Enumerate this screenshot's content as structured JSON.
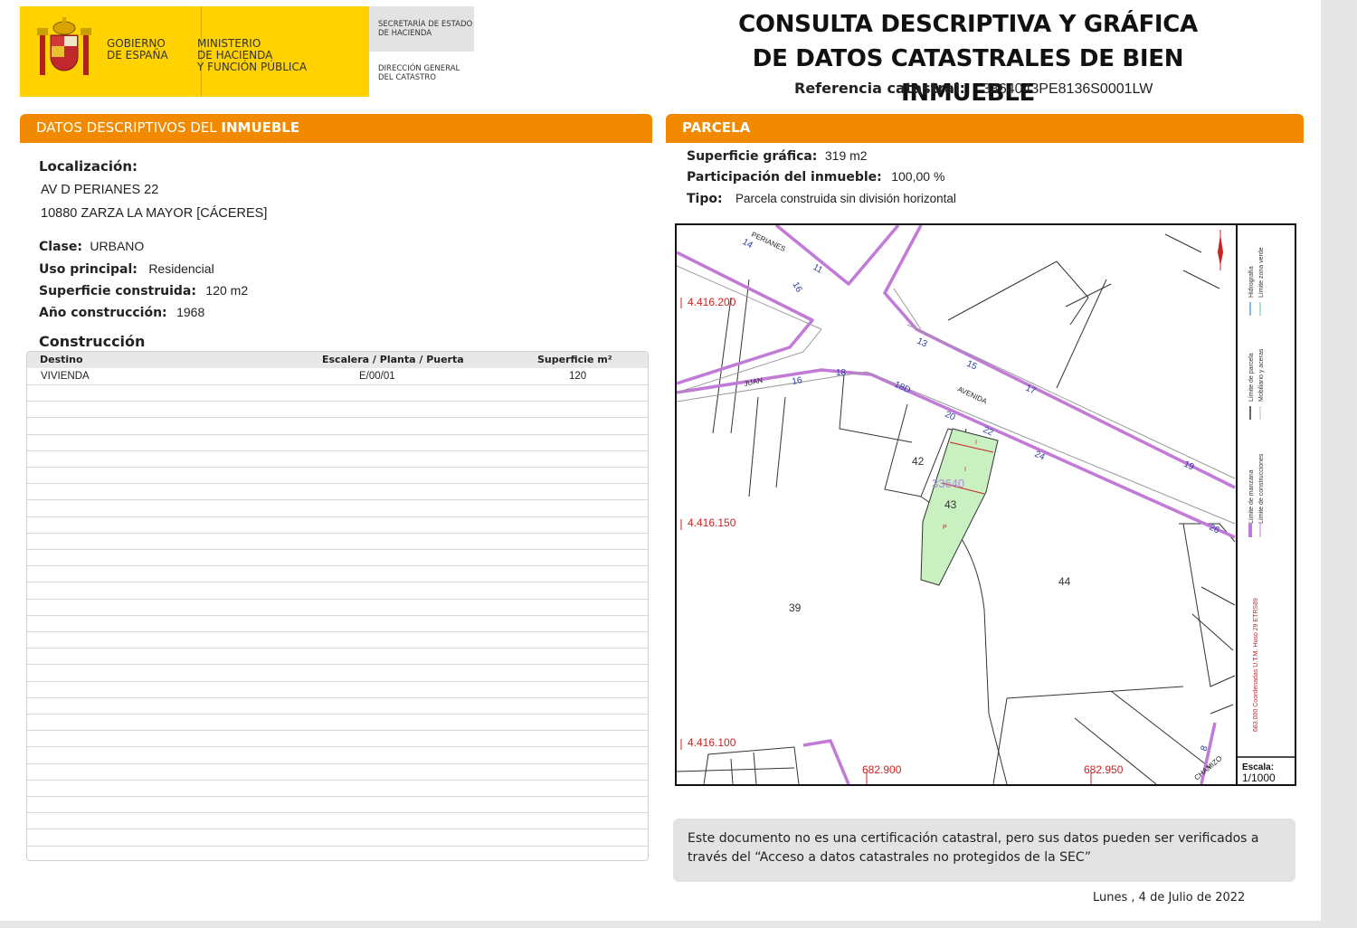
{
  "header": {
    "gobierno": [
      "GOBIERNO",
      "DE ESPAÑA"
    ],
    "ministerio": [
      "MINISTERIO",
      "DE HACIENDA",
      "Y FUNCIÓN PÚBLICA"
    ],
    "secretaria": [
      "SECRETARÍA DE ESTADO",
      "DE HACIENDA"
    ],
    "direccion": [
      "DIRECCIÓN GENERAL",
      "DEL CATASTRO"
    ],
    "title_line1": "CONSULTA DESCRIPTIVA Y GRÁFICA",
    "title_line2": "DE DATOS CATASTRALES DE BIEN INMUEBLE",
    "ref_label": "Referencia catastral:",
    "ref_value": "3364043PE8136S0001LW"
  },
  "left": {
    "section_prefix": "DATOS DESCRIPTIVOS DEL ",
    "section_bold": "INMUEBLE",
    "localizacion_label": "Localización:",
    "address1": "AV D PERIANES 22",
    "address2": "10880 ZARZA LA MAYOR [CÁCERES]",
    "clase_label": "Clase:",
    "clase_value": "URBANO",
    "uso_label": "Uso principal:",
    "uso_value": "Residencial",
    "sup_label": "Superficie construida:",
    "sup_value": "120 m2",
    "anio_label": "Año construcción:",
    "anio_value": "1968",
    "construccion_title": "Construcción",
    "table": {
      "headers": [
        "Destino",
        "Escalera / Planta / Puerta",
        "Superficie m²"
      ],
      "rows": [
        [
          "VIVIENDA",
          "E/00/01",
          "120"
        ]
      ]
    }
  },
  "right": {
    "section": "PARCELA",
    "sup_grafica_label": "Superficie gráfica:",
    "sup_grafica_value": "319 m2",
    "participacion_label": "Participación del inmueble:",
    "participacion_value": "100,00 %",
    "tipo_label": "Tipo:",
    "tipo_value": "Parcela construida sin división horizontal"
  },
  "map": {
    "northing_labels": [
      "4.416.200",
      "4.416.150",
      "4.416.100"
    ],
    "easting_labels": [
      "682.900",
      "682.950"
    ],
    "street_numbers": [
      "14",
      "11",
      "16",
      "13",
      "15",
      "17",
      "16",
      "18",
      "18D",
      "20",
      "22",
      "24",
      "19",
      "26",
      "8"
    ],
    "street_names": [
      "PERIANES",
      "JUAN",
      "AVENIDA",
      "CHAMIZO"
    ],
    "parcel_labels": [
      "42",
      "43",
      "39",
      "44"
    ],
    "highlight_label": "33640",
    "subunit_labels": [
      "I",
      "I",
      "P"
    ],
    "legend": [
      "Límite de manzana",
      "Límite de parcela",
      "Hidrografía",
      "Límite de construcciones",
      "Mobiliario y aceras",
      "Límite zona verde"
    ],
    "coords_note": "683.000 Coordenadas U.T.M. Huso 29 ETRS89",
    "scale_label": "Escala:",
    "scale_value": "1/1000",
    "colors": {
      "block_line": "#c27ad8",
      "parcel_fill": "#c8f0c0",
      "coord_red": "#cc2222",
      "street_num": "#2a3fa8"
    }
  },
  "footer": {
    "note": "Este documento no es una certificación catastral, pero sus datos pueden ser verificados a través del “Acceso a datos catastrales no protegidos de la SEC”",
    "date": "Lunes , 4 de Julio de 2022"
  }
}
